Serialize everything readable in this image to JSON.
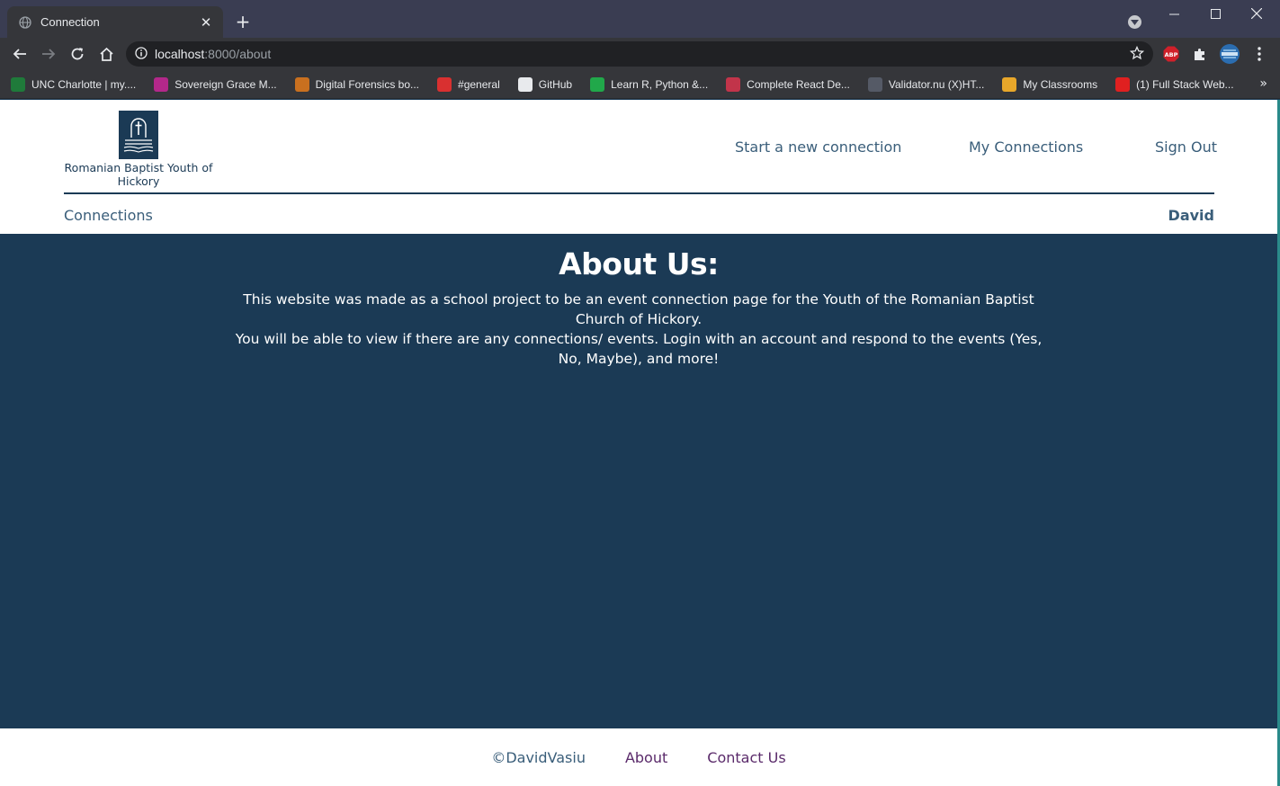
{
  "browser": {
    "tab_title": "Connection",
    "tab_close": "✕",
    "new_tab": "+",
    "url_host": "localhost",
    "url_path": ":8000/about",
    "bookmarks": [
      {
        "label": "UNC Charlotte | my....",
        "color": "#1f7a3a"
      },
      {
        "label": "Sovereign Grace M...",
        "color": "#b3288a"
      },
      {
        "label": "Digital Forensics bo...",
        "color": "#c9701f"
      },
      {
        "label": "#general",
        "color": "#d93030"
      },
      {
        "label": "GitHub",
        "color": "#e8eaed"
      },
      {
        "label": "Learn R, Python &...",
        "color": "#21a84a"
      },
      {
        "label": "Complete React De...",
        "color": "#c2344a"
      },
      {
        "label": "Validator.nu (X)HT...",
        "color": "#555a66"
      },
      {
        "label": "My Classrooms",
        "color": "#e8a72a"
      },
      {
        "label": "(1) Full Stack Web...",
        "color": "#e02020"
      }
    ],
    "bookmarks_more": "»"
  },
  "header": {
    "logo_text": "Romanian Baptist Youth of Hickory",
    "nav": {
      "start": "Start a new connection",
      "mine": "My Connections",
      "signout": "Sign Out"
    },
    "sub_left": "Connections",
    "user": "David"
  },
  "main": {
    "heading": "About Us:",
    "line1": "This website was made as a school project to be an event connection page for the Youth of the Romanian Baptist Church of Hickory.",
    "line2": "You will be able to view if there are any connections/ events. Login with an account and respond to the events (Yes, No, Maybe), and more!"
  },
  "footer": {
    "copyright": "©DavidVasiu",
    "about": "About",
    "contact": "Contact Us"
  }
}
